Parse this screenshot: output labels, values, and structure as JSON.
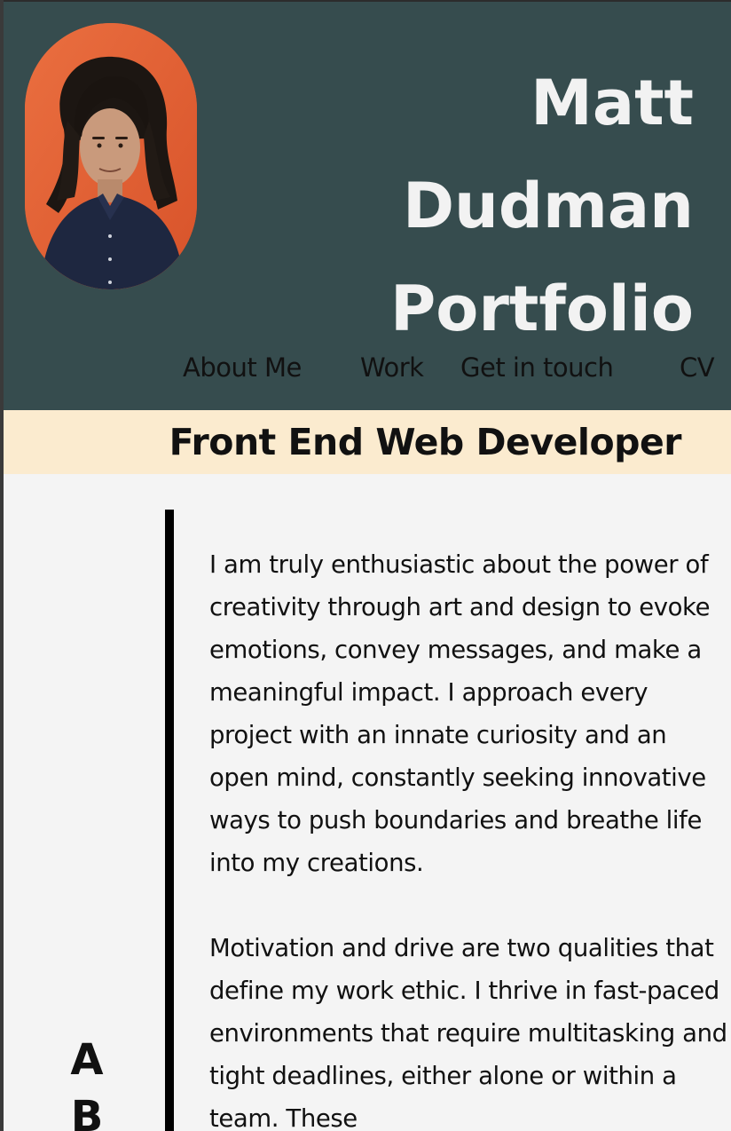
{
  "header": {
    "title_lines": [
      "Matt",
      "Dudman",
      "Portfolio"
    ],
    "background": "#364c4e",
    "avatar": "profile-photo"
  },
  "nav": {
    "items": [
      {
        "label": "About Me"
      },
      {
        "label": "Work"
      },
      {
        "label": "Get in touch"
      },
      {
        "label": "CV"
      }
    ]
  },
  "subtitle": {
    "text": "Front End Web Developer",
    "background": "#fbebcf"
  },
  "about": {
    "side_letters": [
      "A",
      "B"
    ],
    "paragraphs": [
      "I am truly enthusiastic about the power of creativity through art and design to evoke emotions, convey messages, and make a meaningful impact. I approach every project with an innate curiosity and an open mind, constantly seeking innovative ways to push boundaries and breathe life into my creations.",
      "Motivation and drive are two qualities that define my work ethic. I thrive in fast-paced environments that require multitasking and tight deadlines, either alone or within a team. These"
    ]
  }
}
